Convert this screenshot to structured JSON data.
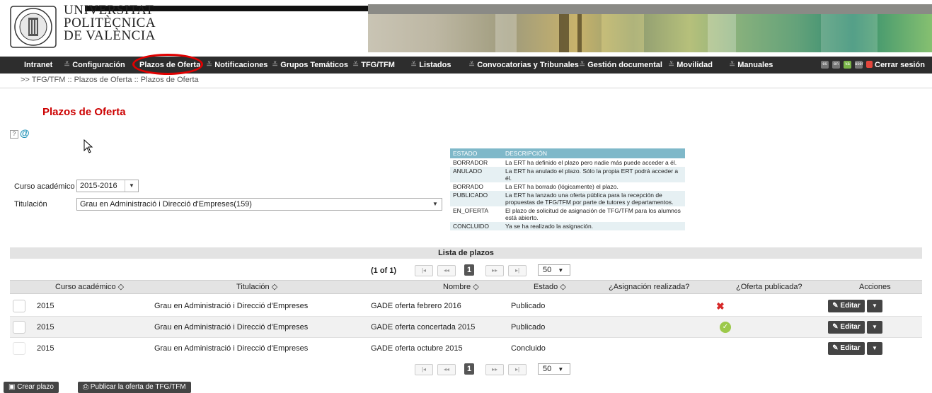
{
  "header": {
    "uni_line1": "UNIVERSITAT",
    "uni_line2": "POLITÈCNICA",
    "uni_line3": "DE VALÈNCIA",
    "logo_text": "UNIVERSITAT POLITÈCNICA DE VALÈNCIA"
  },
  "nav": {
    "items": [
      {
        "label": "Intranet",
        "chev": false
      },
      {
        "label": "Configuración",
        "chev": true
      },
      {
        "label": "Plazos de Oferta",
        "chev": false
      },
      {
        "label": "Notificaciones",
        "chev": true
      },
      {
        "label": "Grupos Temáticos",
        "chev": true
      },
      {
        "label": "TFG/TFM",
        "chev": true
      },
      {
        "label": "Listados",
        "chev": true
      },
      {
        "label": "Convocatorias y Tribunales",
        "chev": true
      },
      {
        "label": "Gestión documental",
        "chev": true
      },
      {
        "label": "Movilidad",
        "chev": true
      },
      {
        "label": "Manuales",
        "chev": true
      }
    ],
    "logout": "Cerrar sesión",
    "icons": [
      "es",
      "en",
      "va",
      "user"
    ],
    "colors": {
      "highlight": "#e00000",
      "bar": "#2d2d2d"
    }
  },
  "breadcrumb": ">> TFG/TFM :: Plazos de Oferta :: Plazos de Oferta",
  "page_title": "Plazos de Oferta",
  "help_icons": [
    "?",
    "@"
  ],
  "legend": {
    "headers": [
      "ESTADO",
      "DESCRIPCIÓN"
    ],
    "rows": [
      [
        "BORRADOR",
        "La ERT ha definido el plazo pero nadie más puede acceder a él."
      ],
      [
        "ANULADO",
        "La ERT ha anulado el plazo. Sólo la propia ERT podrá acceder a él."
      ],
      [
        "BORRADO",
        "La ERT ha borrado (lógicamente) el plazo."
      ],
      [
        "PUBLICADO",
        "La ERT ha lanzado una oferta pública para la recepción de propuestas de TFG/TFM por parte de tutores y departamentos."
      ],
      [
        "EN_OFERTA",
        "El plazo de solicitud de asignación de TFG/TFM para los alumnos está abierto."
      ],
      [
        "CONCLUIDO",
        "Ya se ha realizado la asignación."
      ]
    ]
  },
  "form": {
    "curso_label": "Curso académico",
    "curso_value": "2015-2016",
    "titulacion_label": "Titulación",
    "titulacion_value": "Grau en Administració i Direcció d'Empreses(159)"
  },
  "table": {
    "title": "Lista de plazos",
    "page_info": "(1 of 1)",
    "current_page": "1",
    "rows_per_page": "50",
    "columns": [
      "Curso académico",
      "Titulación",
      "Nombre",
      "Estado",
      "¿Asignación realizada?",
      "¿Oferta publicada?",
      "Acciones"
    ],
    "sort_glyph": "◇",
    "edit_label": "Editar",
    "rows": [
      {
        "curso": "2015",
        "titulacion": "Grau en Administració i Direcció d'Empreses",
        "nombre": "GADE oferta febrero 2016",
        "estado": "Publicado",
        "oferta": "no"
      },
      {
        "curso": "2015",
        "titulacion": "Grau en Administració i Direcció d'Empreses",
        "nombre": "GADE oferta concertada 2015",
        "estado": "Publicado",
        "oferta": "yes"
      },
      {
        "curso": "2015",
        "titulacion": "Grau en Administració i Direcció d'Empreses",
        "nombre": "GADE oferta octubre 2015",
        "estado": "Concluido",
        "oferta": ""
      }
    ]
  },
  "buttons": {
    "crear": "Crear plazo",
    "publicar": "Publicar la oferta de TFG/TFM"
  }
}
